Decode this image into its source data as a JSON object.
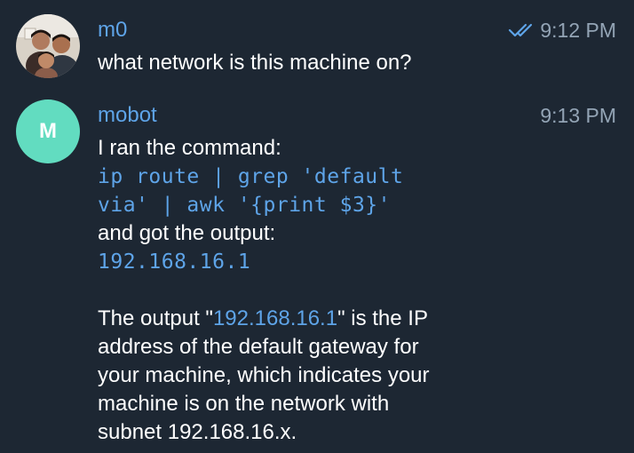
{
  "colors": {
    "background": "#1d2733",
    "sender_name": "#5ea4e8",
    "timestamp": "#93a4b5",
    "code": "#5ea4e8",
    "avatar_bot": "#62dcc0"
  },
  "messages": [
    {
      "sender": "m0",
      "time": "9:12 PM",
      "status_icon": "double-check-icon",
      "avatar": "family-photo",
      "text": "what network is this machine on?"
    },
    {
      "sender": "mobot",
      "time": "9:13 PM",
      "avatar_initial": "M",
      "lines": {
        "intro": "I ran the command:",
        "cmd_1": "ip route | grep 'default",
        "cmd_2": "via' | awk '{print $3}'",
        "got": "and got the output:",
        "output": "192.168.16.1",
        "p_pre": "The output \"",
        "p_ip": "192.168.16.1",
        "p_post": "\" is the IP",
        "p_2": "address of the default gateway for",
        "p_3": "your machine, which indicates your",
        "p_4": "machine is on the network with",
        "p_5": "subnet 192.168.16.x."
      }
    }
  ]
}
